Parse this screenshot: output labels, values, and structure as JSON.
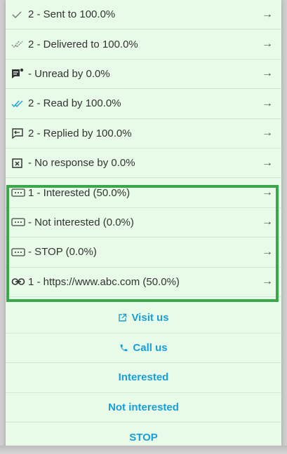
{
  "stats": [
    {
      "icon": "check-icon",
      "text": "2 - Sent to 100.0%"
    },
    {
      "icon": "double-check-icon",
      "text": "2 - Delivered to 100.0%"
    },
    {
      "icon": "unread-message-icon",
      "text": "- Unread by 0.0%"
    },
    {
      "icon": "double-check-blue-icon",
      "text": "2 - Read by 100.0%"
    },
    {
      "icon": "reply-message-icon",
      "text": "2 - Replied by 100.0%"
    },
    {
      "icon": "no-response-icon",
      "text": "- No response by 0.0%"
    },
    {
      "icon": "quick-reply-icon",
      "text": "1 - Interested (50.0%)"
    },
    {
      "icon": "quick-reply-icon",
      "text": "- Not interested (0.0%)"
    },
    {
      "icon": "quick-reply-icon",
      "text": "- STOP (0.0%)"
    },
    {
      "icon": "link-icon",
      "text": "1 - https://www.abc.com (50.0%)"
    }
  ],
  "arrow": "→",
  "actions": [
    {
      "icon": "external-link-icon",
      "label": "Visit us"
    },
    {
      "icon": "phone-icon",
      "label": "Call us"
    },
    {
      "icon": "",
      "label": "Interested"
    },
    {
      "icon": "",
      "label": "Not interested"
    },
    {
      "icon": "",
      "label": "STOP"
    }
  ],
  "colors": {
    "highlight": "#3aa74a",
    "action_text": "#1a9ed6",
    "background": "#e7fbe8",
    "read_check": "#1a9ed6"
  }
}
